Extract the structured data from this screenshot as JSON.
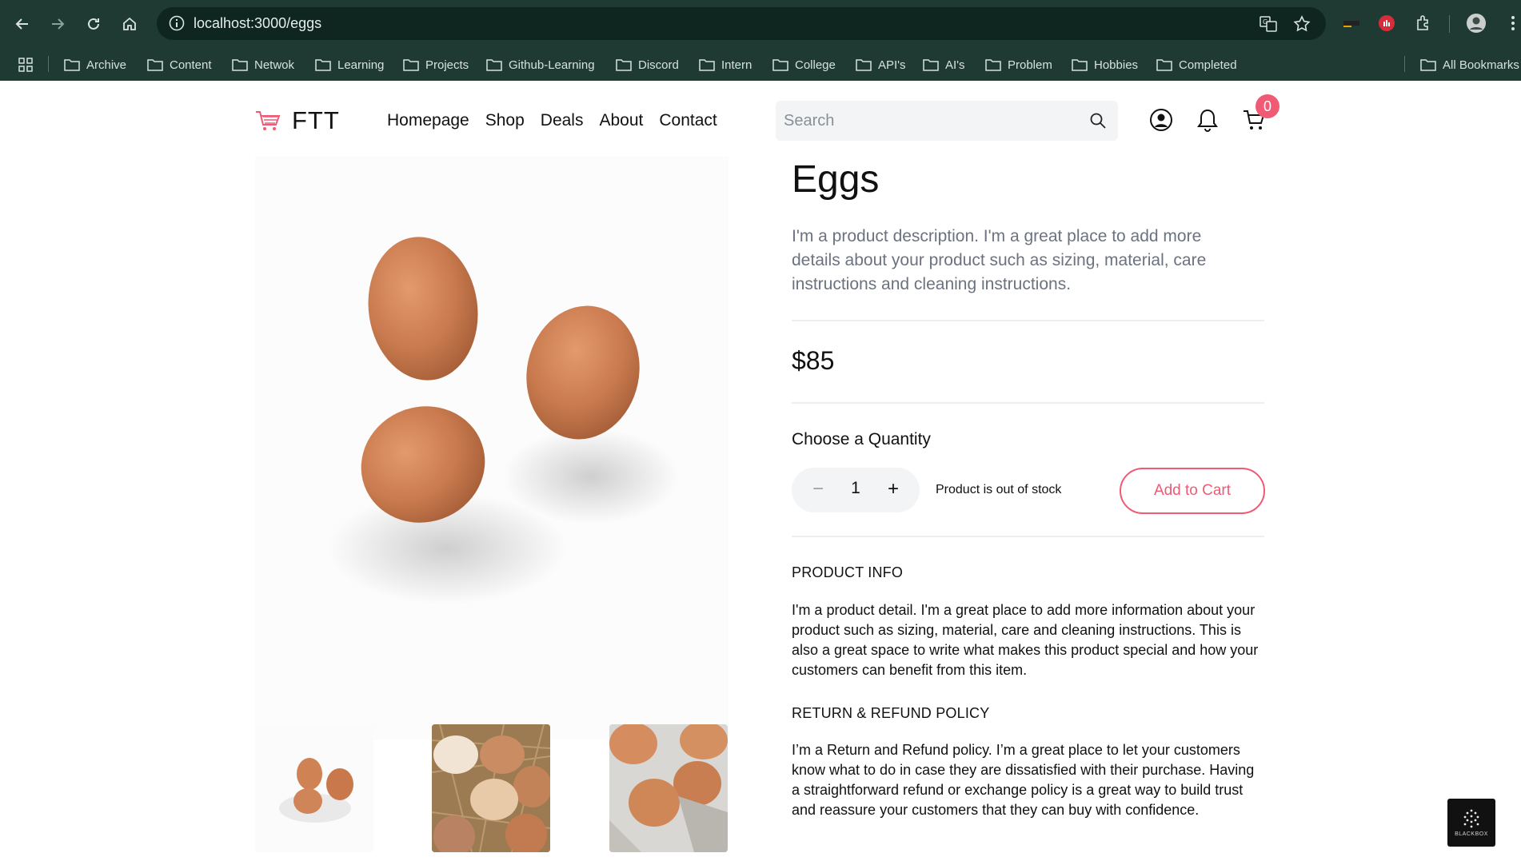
{
  "browser": {
    "url": "localhost:3000/eggs",
    "bookmarks": [
      "Archive",
      "Content",
      "Netwok",
      "Learning",
      "Projects",
      "Github-Learning",
      "Discord",
      "Intern",
      "College",
      "API's",
      "AI's",
      "Problem",
      "Hobbies",
      "Completed"
    ],
    "all_bookmarks": "All Bookmarks"
  },
  "site": {
    "logo_text": "FTT",
    "nav": [
      "Homepage",
      "Shop",
      "Deals",
      "About",
      "Contact"
    ],
    "search_placeholder": "Search",
    "cart_count": "0",
    "accent": "#f05a75"
  },
  "product": {
    "title": "Eggs",
    "description": "I'm a product description. I'm a great place to add more details about your product such as sizing, material, care instructions and cleaning instructions.",
    "price": "$85",
    "quantity_label": "Choose a Quantity",
    "quantity_minus": "−",
    "quantity": "1",
    "quantity_plus": "+",
    "stock_status": "Product is out of stock",
    "add_to_cart": "Add to Cart",
    "info_title": "PRODUCT INFO",
    "info_body": "I'm a product detail. I'm a great place to add more information about your product such as sizing, material, care and cleaning instructions. This is also a great space to write what makes this product special and how your customers can benefit from this item.",
    "policy_title": "RETURN & REFUND POLICY",
    "policy_body": "I’m a Return and Refund policy. I’m a great place to let your customers know what to do in case they are dissatisfied with their purchase. Having a straightforward refund or exchange policy is a great way to build trust and reassure your customers that they can buy with confidence."
  },
  "corner_badge": "BLACKBOX"
}
